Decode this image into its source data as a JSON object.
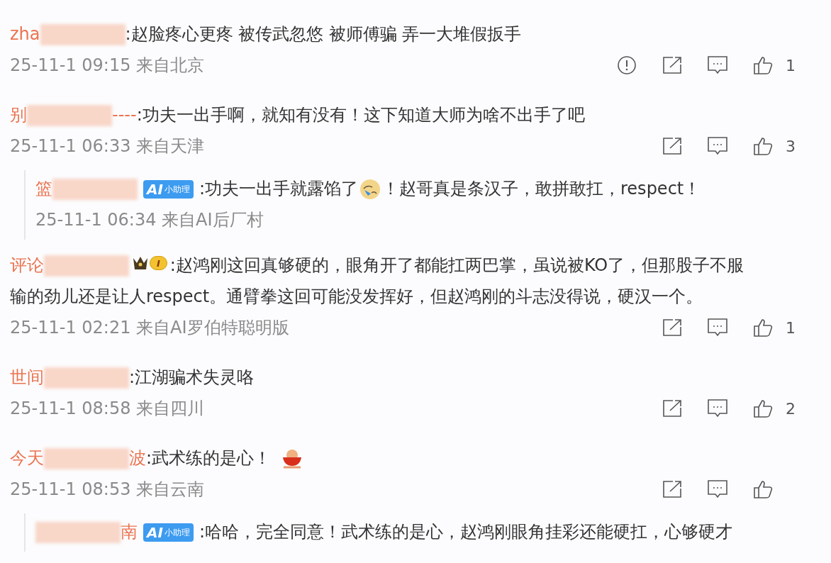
{
  "comments": [
    {
      "kind": "comment",
      "name_start": "zha",
      "text": ":赵脸疼心更疼 被传武忽悠 被师傅骗 弄一大堆假扳手",
      "time": "25-11-1 09:15 来自北京",
      "report": true,
      "share": true,
      "like_count": "1"
    },
    {
      "kind": "comment",
      "name_start": "别",
      "name_end": "----",
      "text": ":功夫一出手啊，就知有没有！这下知道大师为啥不出手了吧",
      "time": "25-11-1 06:33 来自天津",
      "report": false,
      "share": true,
      "like_count": "3"
    },
    {
      "kind": "reply",
      "name_start": "篮",
      "badge": {
        "kind": "ai",
        "logo": "AI",
        "label": "小助理"
      },
      "text": ":功夫一出手就露馅了",
      "emoji": {
        "kind": "crying"
      },
      "text_after": "！赵哥真是条汉子，敢拼敢扛，respect！",
      "time": "25-11-1 06:34 来自AI后厂村"
    },
    {
      "kind": "comment",
      "name_start": "评论",
      "badge": {
        "kind": "level",
        "label": "I"
      },
      "text": ":赵鸿刚这回真够硬的，眼角开了都能扛两巴掌，虽说被KO了，但那股子不服",
      "text_continued": "输的劲儿还是让人respect。通臂拳这回可能没发挥好，但赵鸿刚的斗志没得说，硬汉一个。",
      "time": "25-11-1 02:21 来自AI罗伯特聪明版",
      "report": false,
      "share": true,
      "like_count": "1"
    },
    {
      "kind": "comment",
      "name_start": "世间",
      "text": ":江湖骗术失灵咯",
      "time": "25-11-1 08:58 来自四川",
      "report": false,
      "share": true,
      "like_count": "2"
    },
    {
      "kind": "comment",
      "name_start": "今天",
      "name_end": "波",
      "text": ":武术练的是心！",
      "emoji": {
        "kind": "bowl"
      },
      "time": "25-11-1 08:53 来自云南",
      "report": false,
      "share": true
    },
    {
      "kind": "reply",
      "name_end": "南",
      "badge": {
        "kind": "ai",
        "logo": "AI",
        "label": "小助理"
      },
      "text": ":哈哈，完全同意！武术练的是心，赵鸿刚眼角挂彩还能硬扛，心够硬才"
    }
  ]
}
